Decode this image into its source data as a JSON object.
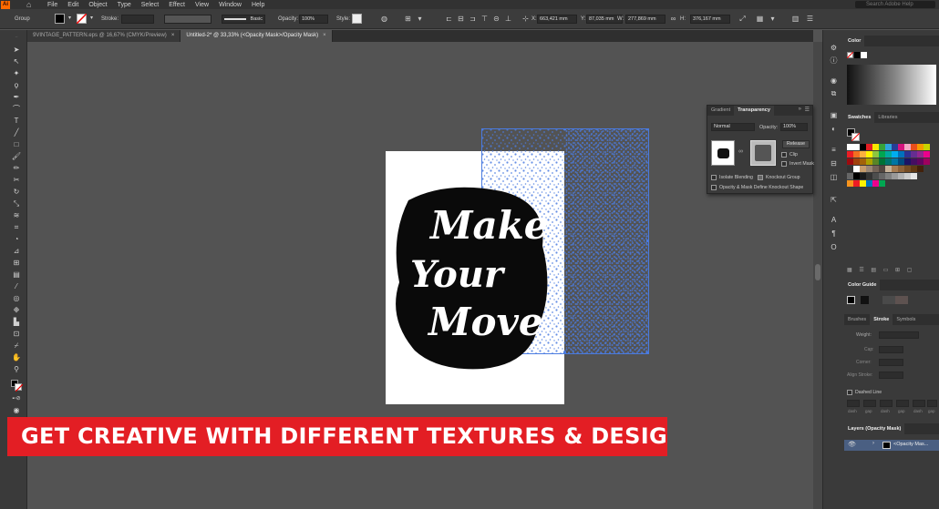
{
  "app": {
    "logo": "Ai",
    "home_icon": "home-icon"
  },
  "menu": [
    "File",
    "Edit",
    "Object",
    "Type",
    "Select",
    "Effect",
    "View",
    "Window",
    "Help"
  ],
  "search_placeholder": "Search Adobe Help",
  "control_bar": {
    "selection": "Group",
    "stroke_label": "Stroke:",
    "brush": "Basic",
    "opacity_label": "Opacity:",
    "opacity_value": "100%",
    "style_label": "Style:",
    "x_label": "X:",
    "x_value": "663,421 mm",
    "y_label": "Y:",
    "y_value": "87,035 mm",
    "w_label": "W:",
    "w_value": "277,869 mm",
    "h_label": "H:",
    "h_value": "376,167 mm"
  },
  "tabs": [
    {
      "label": "9VINTAGE_PATTERN.eps @ 16,67% (CMYK/Preview)",
      "close": "×"
    },
    {
      "label": "Untitled-2* @ 33,33% (<Opacity Mask>/Opacity Mask)",
      "close": "×"
    }
  ],
  "artwork": {
    "lines": [
      "Make",
      "Your",
      "Move"
    ]
  },
  "banner": "GET CREATIVE WITH DIFFERENT TEXTURES & DESIGNS",
  "transparency_panel": {
    "tabs": [
      "Gradient",
      "Transparency"
    ],
    "blend_mode": "Normal",
    "opacity_label": "Opacity:",
    "opacity_value": "100%",
    "release": "Release",
    "clip": "Clip",
    "invert_mask": "Invert Mask",
    "isolate_blending": "Isolate Blending",
    "knockout_group": "Knockout Group",
    "opacity_mask_define": "Opacity & Mask Define Knockout Shape"
  },
  "right_panel": {
    "color_tab": "Color",
    "swatches_tabs": [
      "Swatches",
      "Libraries"
    ],
    "color_guide_tab": "Color Guide",
    "stroke_tabs": [
      "Brushes",
      "Stroke",
      "Symbols"
    ],
    "weight_label": "Weight:",
    "cap_label": "Cap:",
    "corner_label": "Corner:",
    "align_stroke_label": "Align Stroke:",
    "dashed_line": "Dashed Line",
    "dash_labels": [
      "dash",
      "gap",
      "dash",
      "gap",
      "dash",
      "gap"
    ],
    "layers_tab": "Layers (Opacity Mask)",
    "layer_name": "<Opacity Mas..."
  },
  "colors": {
    "accent_banner": "#e31e24",
    "selection_blue": "#4a7be0"
  }
}
